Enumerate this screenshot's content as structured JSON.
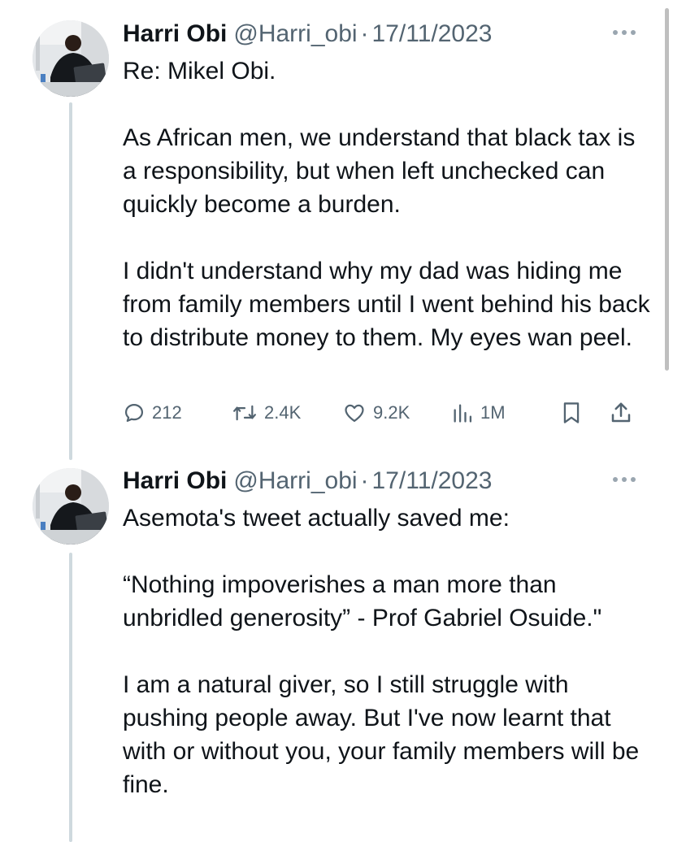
{
  "tweets": [
    {
      "author_name": "Harri Obi",
      "handle": "@Harri_obi",
      "separator": "·",
      "date": "17/11/2023",
      "paragraphs": [
        "Re: Mikel Obi.",
        "As African men, we understand that black tax is a responsibility, but when left unchecked can quickly become a burden.",
        "I didn't understand why my dad was hiding me from family members until I went behind his back to distribute money to them. My eyes wan peel."
      ],
      "replies": "212",
      "retweets": "2.4K",
      "likes": "9.2K",
      "views": "1M"
    },
    {
      "author_name": "Harri Obi",
      "handle": "@Harri_obi",
      "separator": "·",
      "date": "17/11/2023",
      "paragraphs": [
        "Asemota's tweet actually saved me:",
        "“Nothing impoverishes a man more than unbridled generosity” - Prof Gabriel Osuide.\"",
        "I am a natural giver, so I still struggle with pushing people away. But I've now learnt that with or without you, your family members will be fine."
      ]
    }
  ],
  "icons": {
    "more": "more-icon",
    "reply": "reply-icon",
    "retweet": "retweet-icon",
    "like": "heart-icon",
    "views": "views-icon",
    "bookmark": "bookmark-icon",
    "share": "share-icon"
  },
  "colors": {
    "text": "#0f1419",
    "secondary": "#536471",
    "thread_line": "#cfd9de"
  }
}
